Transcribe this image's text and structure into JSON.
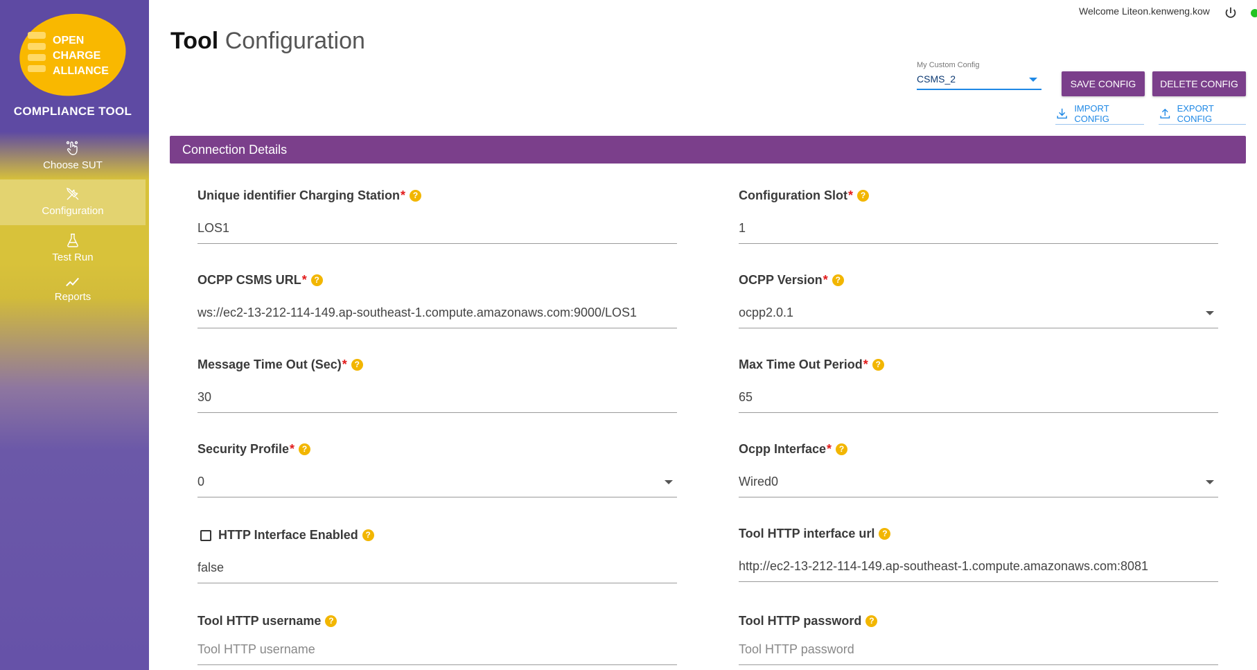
{
  "sidebar": {
    "logo_text": "OPEN\nCHARGE\nALLIANCE",
    "app_title": "COMPLIANCE TOOL",
    "items": [
      {
        "label": "Choose SUT",
        "icon": "pointer-hand-icon"
      },
      {
        "label": "Configuration",
        "icon": "tools-icon",
        "active": true
      },
      {
        "label": "Test Run",
        "icon": "flask-icon"
      },
      {
        "label": "Reports",
        "icon": "trend-chart-icon"
      }
    ]
  },
  "header": {
    "title_bold": "Tool",
    "title_light": "Configuration",
    "welcome": "Welcome Liteon.kenweng.kow",
    "status_color": "#22c322"
  },
  "config_select": {
    "label": "My Custom Config",
    "value": "CSMS_2"
  },
  "toolbar": {
    "save_label": "SAVE CONFIG",
    "delete_label": "DELETE CONFIG",
    "import_label": "IMPORT CONFIG",
    "export_label": "EXPORT CONFIG"
  },
  "section": {
    "title": "Connection Details"
  },
  "fields": {
    "unique_id": {
      "label": "Unique identifier Charging Station",
      "required": "*",
      "value": "LOS1"
    },
    "config_slot": {
      "label": "Configuration Slot",
      "required": "*",
      "value": "1"
    },
    "csms_url": {
      "label": "OCPP CSMS URL",
      "required": "*",
      "value": "ws://ec2-13-212-114-149.ap-southeast-1.compute.amazonaws.com:9000/LOS1"
    },
    "ocpp_version": {
      "label": "OCPP Version",
      "required": "*",
      "value": "ocpp2.0.1"
    },
    "msg_timeout": {
      "label": "Message Time Out (Sec)",
      "required": "*",
      "value": "30"
    },
    "max_timeout": {
      "label": "Max Time Out Period",
      "required": "*",
      "value": "65"
    },
    "security_profile": {
      "label": "Security Profile",
      "required": "*",
      "value": "0"
    },
    "ocpp_interface": {
      "label": "Ocpp Interface",
      "required": "*",
      "value": "Wired0"
    },
    "http_enabled": {
      "label": "HTTP Interface Enabled",
      "value": "false"
    },
    "http_url": {
      "label": "Tool HTTP interface url",
      "value": "http://ec2-13-212-114-149.ap-southeast-1.compute.amazonaws.com:8081"
    },
    "http_username": {
      "label": "Tool HTTP username",
      "placeholder": "Tool HTTP username"
    },
    "http_password": {
      "label": "Tool HTTP password",
      "placeholder": "Tool HTTP password"
    }
  },
  "help_glyph": "?"
}
